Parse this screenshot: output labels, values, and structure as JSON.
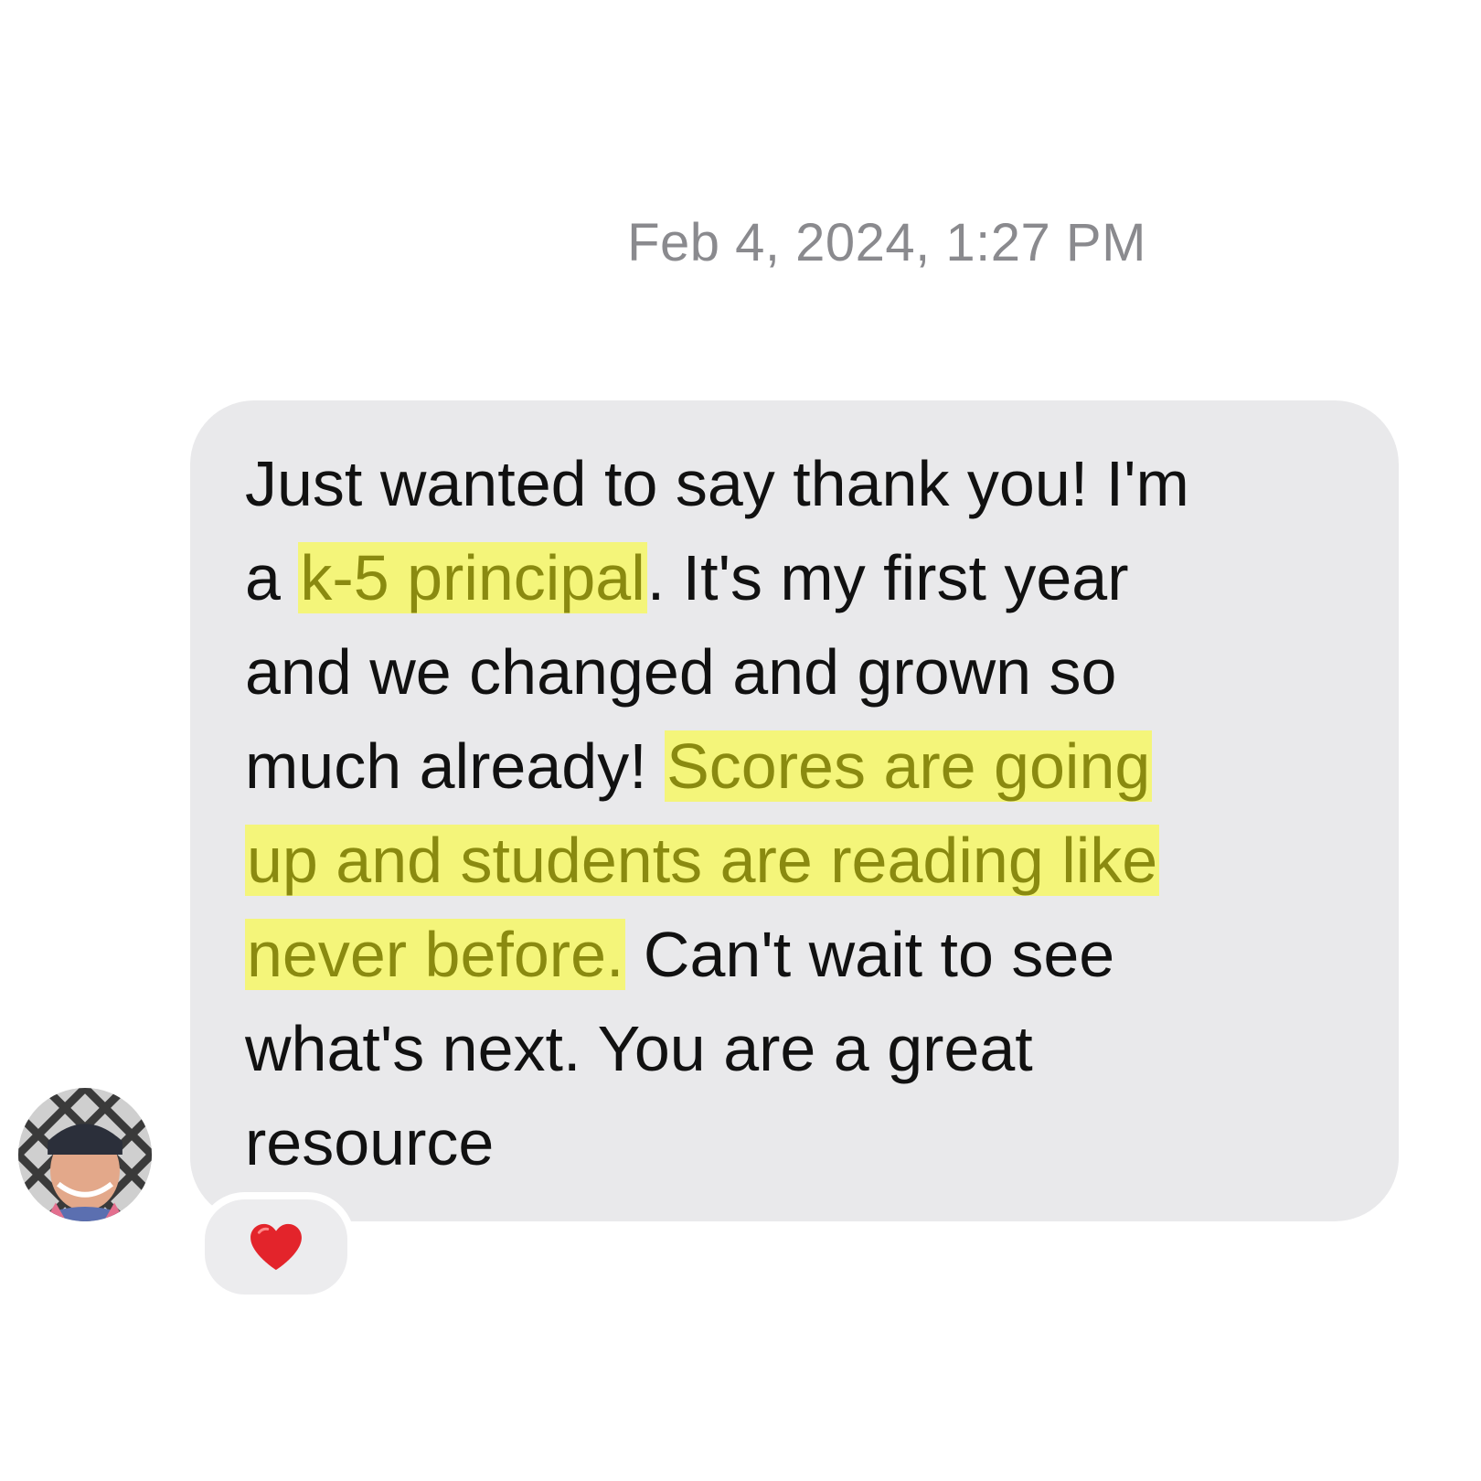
{
  "timestamp": "Feb 4, 2024, 1:27 PM",
  "message": {
    "line1": "Just wanted to say thank you! I'm",
    "line2_prefix": "a ",
    "line2_highlight": "k-5 principal",
    "line2_suffix": ". It's my first year",
    "line3": "and we changed and grown so",
    "line4_prefix": "much already! ",
    "line4_highlight": "Scores are going",
    "line5_highlight": "up and students are reading like",
    "line6_highlight": "never before.",
    "line6_suffix": " Can't wait to see",
    "line7": "what's next. You are a great",
    "line8": "resource"
  },
  "reaction": {
    "icon": "heart-icon",
    "color": "#e3242b"
  },
  "colors": {
    "bubble": "#e9e9eb",
    "highlight_bg": "#f4f57a",
    "highlight_text": "#8a8a10",
    "timestamp": "#8a8a8e"
  }
}
